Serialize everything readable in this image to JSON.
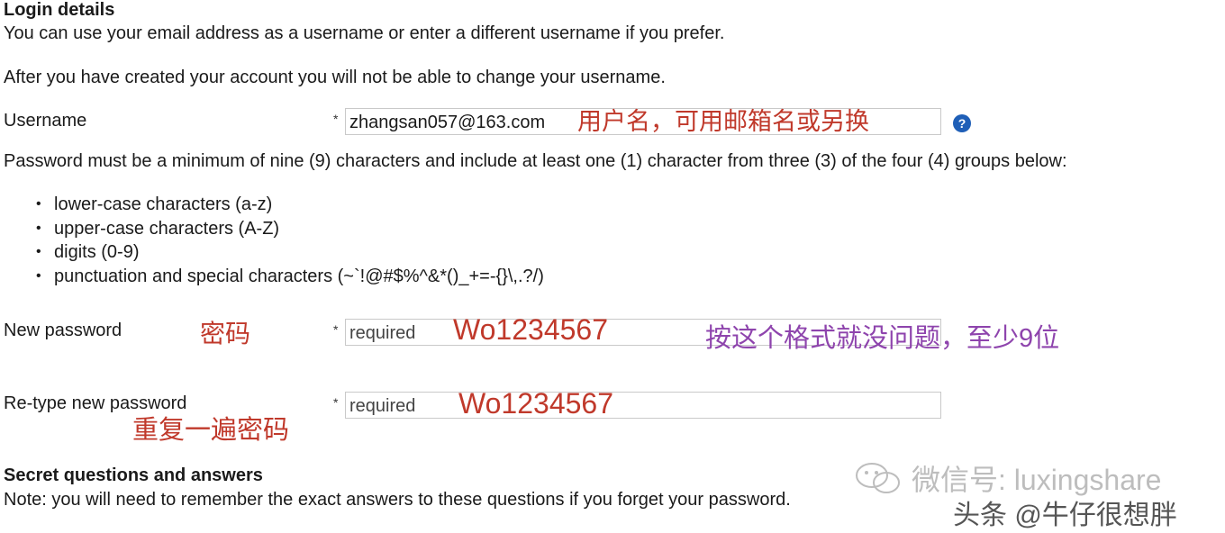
{
  "section_login": {
    "heading": "Login details",
    "intro": "You can use your email address as a username or enter a different username if you prefer.",
    "note": "After you have created your account you will not be able to change your username."
  },
  "username": {
    "label": "Username",
    "required_mark": "*",
    "value": "zhangsan057@163.com",
    "annotation": "用户名，可用邮箱名或另换",
    "help_icon": "?"
  },
  "password_rules": {
    "intro": "Password must be a minimum of nine (9) characters and include at least one (1) character from three (3) of the four (4) groups below:",
    "items": [
      "lower-case characters (a-z)",
      "upper-case characters (A-Z)",
      "digits (0-9)",
      "punctuation and special characters (~`!@#$%^&*()_+=-{}\\,.?/)"
    ]
  },
  "new_password": {
    "label": "New password",
    "required_mark": "*",
    "placeholder": "required",
    "annotation_label": "密码",
    "annotation_value": "Wo1234567",
    "annotation_note": "按这个格式就没问题，至少9位"
  },
  "retype_password": {
    "label": "Re-type new password",
    "required_mark": "*",
    "placeholder": "required",
    "annotation_label": "重复一遍密码",
    "annotation_value": "Wo1234567"
  },
  "section_secret": {
    "heading": "Secret questions and answers",
    "note": "Note: you will need to remember the exact answers to these questions if you forget your password."
  },
  "watermarks": {
    "wechat": "微信号: luxingshare",
    "toutiao": "头条 @牛仔很想胖"
  },
  "colors": {
    "annotation_red": "#c0392b",
    "annotation_purple": "#8e44ad",
    "help_icon_blue": "#1f5fb7"
  }
}
